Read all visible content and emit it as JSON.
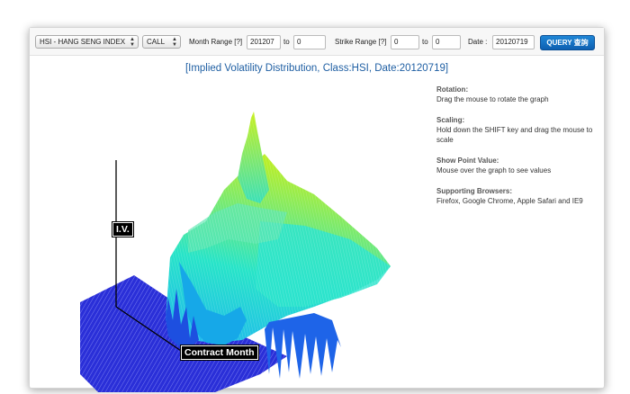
{
  "toolbar": {
    "class_select": "HSI - HANG SENG INDEX",
    "type_select": "CALL",
    "month_range_label": "Month Range [?]",
    "month_from": "201207",
    "to1": "to",
    "month_to": "0",
    "strike_range_label": "Strike Range [?]",
    "strike_from": "0",
    "to2": "to",
    "strike_to": "0",
    "date_label": "Date :",
    "date_value": "20120719",
    "query_button": "QUERY 查詢"
  },
  "title": "[Implied Volatility Distribution, Class:HSI, Date:20120719]",
  "info": {
    "rotation_head": "Rotation:",
    "rotation_text": "Drag the mouse to rotate the graph",
    "scaling_head": "Scaling:",
    "scaling_text": "Hold down the SHIFT key and drag the mouse to scale",
    "point_head": "Show Point Value:",
    "point_text": "Mouse over the graph to see values",
    "browsers_head": "Supporting Browsers:",
    "browsers_text": "Firefox, Google Chrome, Apple Safari and IE9"
  },
  "plot": {
    "y_axis_label": "I.V.",
    "x_axis_label": "Contract Month",
    "colors": {
      "floor": "#2a2fd8",
      "low": "#1fb6f0",
      "mid": "#27e4c8",
      "high": "#b8ee2a"
    }
  }
}
